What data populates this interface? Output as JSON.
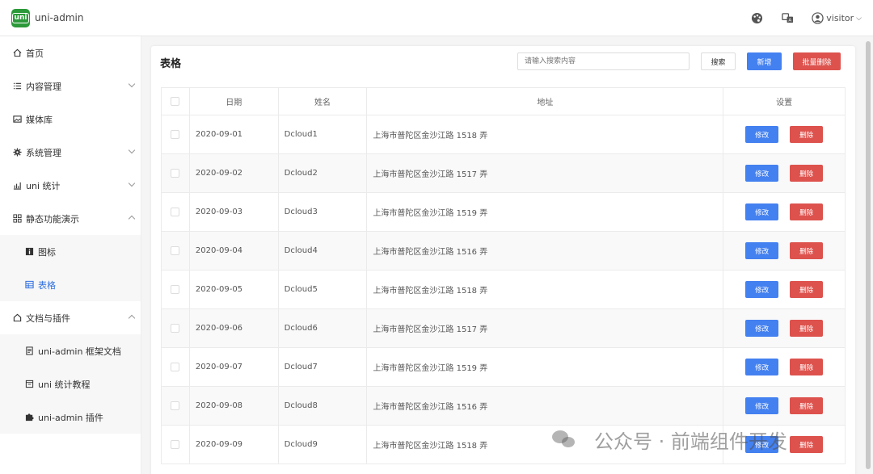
{
  "app": {
    "logo_text": "uni",
    "title": "uni-admin"
  },
  "topbar": {
    "user_name": "visitor"
  },
  "sidebar": {
    "items": [
      {
        "label": "首页",
        "icon": "home-icon"
      },
      {
        "label": "内容管理",
        "icon": "list-icon"
      },
      {
        "label": "媒体库",
        "icon": "image-icon"
      },
      {
        "label": "系统管理",
        "icon": "gear-icon"
      },
      {
        "label": "uni 统计",
        "icon": "chart-icon"
      },
      {
        "label": "静态功能演示",
        "icon": "grid-icon"
      },
      {
        "label": "图标",
        "icon": "icon-icon"
      },
      {
        "label": "表格",
        "icon": "table-icon"
      },
      {
        "label": "文档与插件",
        "icon": "house-icon"
      },
      {
        "label": "uni-admin 框架文档",
        "icon": "doc-icon"
      },
      {
        "label": "uni 统计教程",
        "icon": "calendar-icon"
      },
      {
        "label": "uni-admin 插件",
        "icon": "puzzle-icon"
      }
    ]
  },
  "main": {
    "title": "表格",
    "search_placeholder": "请输入搜索内容",
    "search_button": "搜索",
    "add_button": "新增",
    "batch_delete_button": "批量删除",
    "columns": [
      "日期",
      "姓名",
      "地址",
      "设置"
    ],
    "edit_label": "修改",
    "delete_label": "删除",
    "rows": [
      {
        "date": "2020-09-01",
        "name": "Dcloud1",
        "address": "上海市普陀区金沙江路 1518 弄"
      },
      {
        "date": "2020-09-02",
        "name": "Dcloud2",
        "address": "上海市普陀区金沙江路 1517 弄"
      },
      {
        "date": "2020-09-03",
        "name": "Dcloud3",
        "address": "上海市普陀区金沙江路 1519 弄"
      },
      {
        "date": "2020-09-04",
        "name": "Dcloud4",
        "address": "上海市普陀区金沙江路 1516 弄"
      },
      {
        "date": "2020-09-05",
        "name": "Dcloud5",
        "address": "上海市普陀区金沙江路 1518 弄"
      },
      {
        "date": "2020-09-06",
        "name": "Dcloud6",
        "address": "上海市普陀区金沙江路 1517 弄"
      },
      {
        "date": "2020-09-07",
        "name": "Dcloud7",
        "address": "上海市普陀区金沙江路 1519 弄"
      },
      {
        "date": "2020-09-08",
        "name": "Dcloud8",
        "address": "上海市普陀区金沙江路 1516 弄"
      },
      {
        "date": "2020-09-09",
        "name": "Dcloud9",
        "address": "上海市普陀区金沙江路 1518 弄"
      }
    ]
  },
  "watermark": {
    "text": "公众号 · 前端组件开发"
  },
  "colors": {
    "brand": "#2b9939",
    "primary": "#4380f0",
    "danger": "#dd524d",
    "active_menu": "#2f6fde"
  }
}
